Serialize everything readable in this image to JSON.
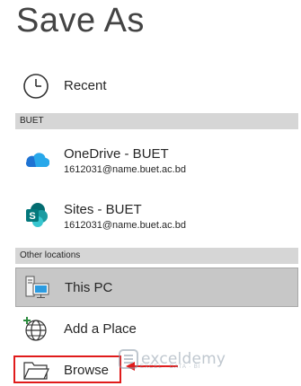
{
  "page_title": "Save As",
  "recent": {
    "label": "Recent",
    "icon": "clock-icon"
  },
  "sections": {
    "buet": "BUET",
    "other": "Other locations"
  },
  "onedrive": {
    "label": "OneDrive - BUET",
    "account": "1612031@name.buet.ac.bd",
    "icon": "onedrive-cloud-icon"
  },
  "sites": {
    "label": "Sites - BUET",
    "account": "1612031@name.buet.ac.bd",
    "icon": "sharepoint-icon"
  },
  "this_pc": {
    "label": "This PC",
    "icon": "computer-icon"
  },
  "add_place": {
    "label": "Add a Place",
    "icon": "globe-plus-icon"
  },
  "browse": {
    "label": "Browse",
    "icon": "folder-icon"
  },
  "watermark": {
    "brand": "exceldemy",
    "tagline": "EXCEL · DATA · BI"
  },
  "colors": {
    "highlight": "#e01b1b",
    "section_bg": "#d6d6d6",
    "selected_bg": "#c7c7c7",
    "onedrive_blue": "#1e73d3",
    "sharepoint_teal": "#03787c"
  }
}
